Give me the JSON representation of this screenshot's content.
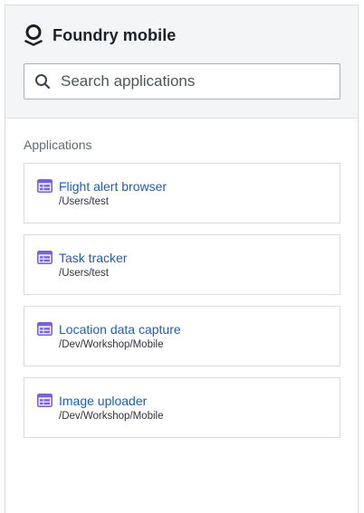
{
  "header": {
    "title": "Foundry mobile",
    "logo_icon": "palantir-logo-icon"
  },
  "search": {
    "placeholder": "Search applications",
    "value": "",
    "icon": "search-icon"
  },
  "section": {
    "label": "Applications"
  },
  "applications": [
    {
      "name": "Flight alert browser",
      "path": "/Users/test",
      "icon": "workshop-app-icon"
    },
    {
      "name": "Task tracker",
      "path": "/Users/test",
      "icon": "workshop-app-icon"
    },
    {
      "name": "Location data capture",
      "path": "/Dev/Workshop/Mobile",
      "icon": "workshop-app-icon"
    },
    {
      "name": "Image uploader",
      "path": "/Dev/Workshop/Mobile",
      "icon": "workshop-app-icon"
    }
  ],
  "colors": {
    "link": "#215db0",
    "app_icon": "#7961db",
    "header_bg": "#f4f5f7"
  }
}
